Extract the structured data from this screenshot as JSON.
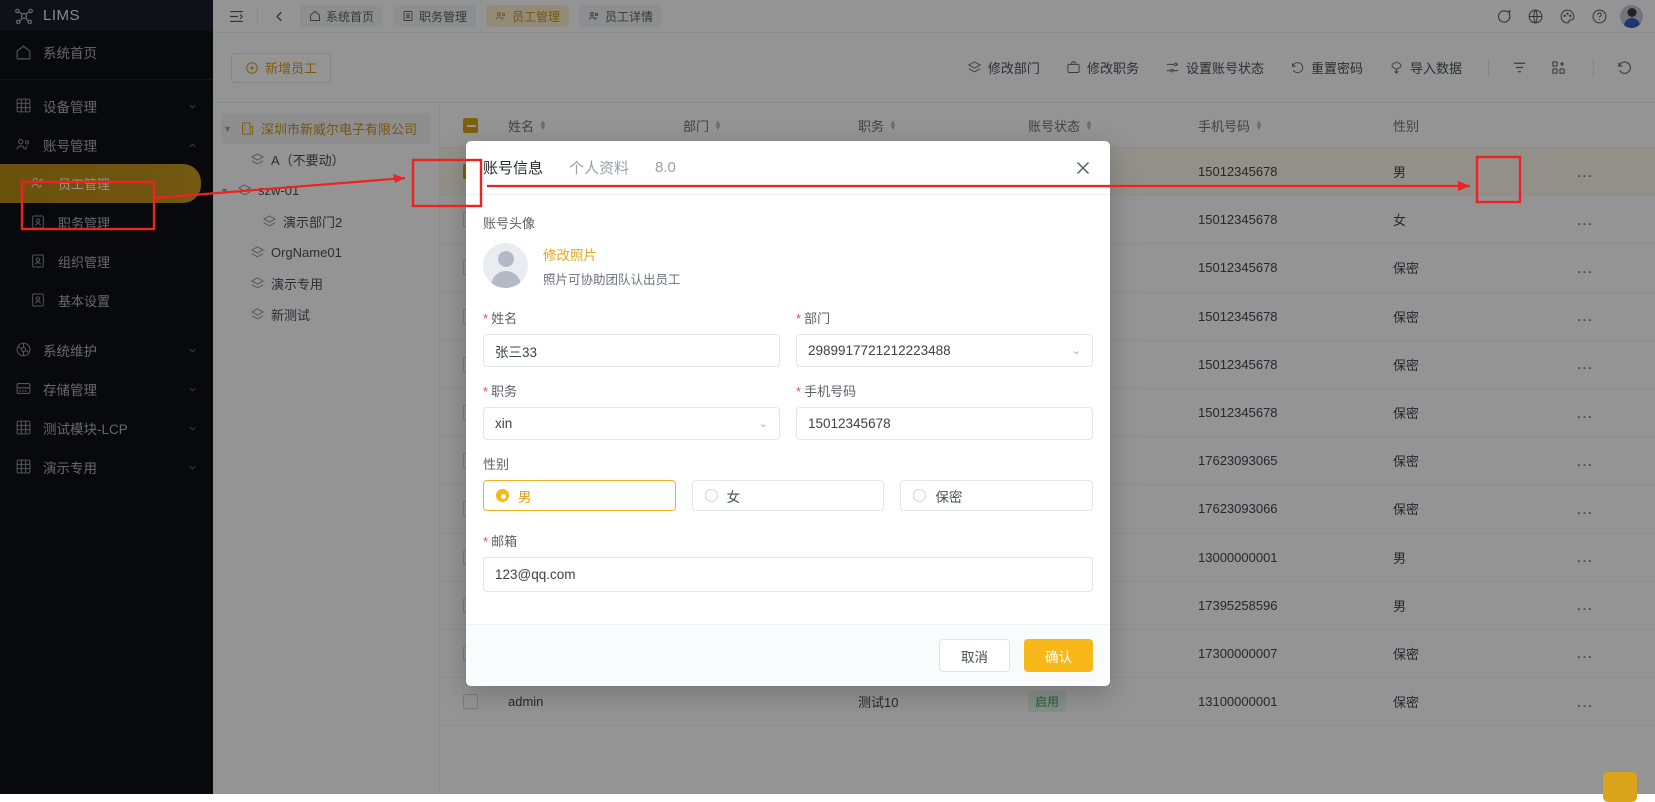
{
  "app": {
    "brand": "LIMS",
    "logo_icon": "molecule-logo-icon"
  },
  "sidebar": {
    "home": {
      "label": "系统首页",
      "icon": "home-icon"
    },
    "groups": [
      {
        "label": "设备管理",
        "icon": "grid-icon",
        "chevron": "chevron-down-icon",
        "expanded": false
      },
      {
        "label": "账号管理",
        "icon": "users-icon",
        "chevron": "chevron-up-icon",
        "expanded": true,
        "children": [
          {
            "label": "员工管理",
            "icon": "users-icon",
            "active": true
          },
          {
            "label": "职务管理",
            "icon": "id-card-icon",
            "active": false
          },
          {
            "label": "组织管理",
            "icon": "id-card-icon",
            "active": false
          },
          {
            "label": "基本设置",
            "icon": "id-card-icon",
            "active": false
          }
        ]
      },
      {
        "label": "系统维护",
        "icon": "wheel-icon",
        "chevron": "chevron-down-icon",
        "expanded": false
      },
      {
        "label": "存储管理",
        "icon": "storage-icon",
        "chevron": "chevron-down-icon",
        "expanded": false
      },
      {
        "label": "测试模块-LCP",
        "icon": "grid-icon",
        "chevron": "chevron-down-icon",
        "expanded": false
      },
      {
        "label": "演示专用",
        "icon": "grid-icon",
        "chevron": "chevron-down-icon",
        "expanded": false
      }
    ]
  },
  "topbar": {
    "collapse_icon": "sidebar-collapse-icon",
    "back_icon": "chevron-left-icon",
    "tabs": [
      {
        "label": "系统首页",
        "icon": "home-icon",
        "active": false
      },
      {
        "label": "职务管理",
        "icon": "id-card-icon",
        "active": false
      },
      {
        "label": "员工管理",
        "icon": "users-icon",
        "active": true
      },
      {
        "label": "员工详情",
        "icon": "users-icon",
        "active": false
      }
    ],
    "right_icons": [
      "chat-icon",
      "globe-icon",
      "palette-icon",
      "help-icon"
    ],
    "avatar": "user-avatar"
  },
  "actionbar": {
    "add_label": "新增员工",
    "add_icon": "plus-circle-icon",
    "actions": [
      {
        "label": "修改部门",
        "icon": "layers-icon"
      },
      {
        "label": "修改职务",
        "icon": "briefcase-icon"
      },
      {
        "label": "设置账号状态",
        "icon": "sliders-icon"
      },
      {
        "label": "重置密码",
        "icon": "reset-icon"
      },
      {
        "label": "导入数据",
        "icon": "import-icon"
      }
    ],
    "tool_icons": [
      "filter-icon",
      "columns-icon",
      "refresh-icon"
    ]
  },
  "tree": {
    "root": {
      "label": "深圳市新威尔电子有限公司",
      "icon": "company-icon",
      "caret": "caret-down-icon"
    },
    "nodes": [
      {
        "label": "A（不要动）",
        "icon": "layers-icon",
        "indent": 1,
        "caret": ""
      },
      {
        "label": "szw-01",
        "icon": "layers-icon",
        "indent": 1,
        "caret": "caret-down-icon"
      },
      {
        "label": "演示部门2",
        "icon": "layers-icon",
        "indent": 2,
        "caret": ""
      },
      {
        "label": "OrgName01",
        "icon": "layers-icon",
        "indent": 1,
        "caret": ""
      },
      {
        "label": "演示专用",
        "icon": "layers-icon",
        "indent": 1,
        "caret": ""
      },
      {
        "label": "新测试",
        "icon": "layers-icon",
        "indent": 1,
        "caret": ""
      }
    ]
  },
  "table": {
    "columns": [
      {
        "key": "name",
        "label": "姓名",
        "sortable": true
      },
      {
        "key": "dept",
        "label": "部门",
        "sortable": true
      },
      {
        "key": "job",
        "label": "职务",
        "sortable": true
      },
      {
        "key": "stat",
        "label": "账号状态",
        "sortable": true
      },
      {
        "key": "phone",
        "label": "手机号码",
        "sortable": true
      },
      {
        "key": "sex",
        "label": "性别",
        "sortable": false
      }
    ],
    "op_label": "…",
    "rows": [
      {
        "checked": true,
        "name": "",
        "dept": "",
        "job": "",
        "stat": "",
        "phone": "15012345678",
        "sex": "男"
      },
      {
        "checked": false,
        "name": "",
        "dept": "",
        "job": "",
        "stat": "",
        "phone": "15012345678",
        "sex": "女"
      },
      {
        "checked": false,
        "name": "",
        "dept": "",
        "job": "",
        "stat": "",
        "phone": "15012345678",
        "sex": "保密"
      },
      {
        "checked": false,
        "name": "",
        "dept": "",
        "job": "",
        "stat": "",
        "phone": "15012345678",
        "sex": "保密"
      },
      {
        "checked": false,
        "name": "",
        "dept": "",
        "job": "",
        "stat": "",
        "phone": "15012345678",
        "sex": "保密"
      },
      {
        "checked": false,
        "name": "",
        "dept": "",
        "job": "",
        "stat": "",
        "phone": "15012345678",
        "sex": "保密"
      },
      {
        "checked": false,
        "name": "",
        "dept": "",
        "job": "",
        "stat": "",
        "phone": "17623093065",
        "sex": "保密"
      },
      {
        "checked": false,
        "name": "",
        "dept": "",
        "job": "",
        "stat": "",
        "phone": "17623093066",
        "sex": "保密"
      },
      {
        "checked": false,
        "name": "",
        "dept": "",
        "job": "",
        "stat": "",
        "phone": "13000000001",
        "sex": "男"
      },
      {
        "checked": false,
        "name": "",
        "dept": "",
        "job": "",
        "stat": "",
        "phone": "17395258596",
        "sex": "男"
      },
      {
        "checked": false,
        "name": "",
        "dept": "",
        "job": "",
        "stat": "",
        "phone": "17300000007",
        "sex": "保密"
      },
      {
        "checked": false,
        "name": "admin",
        "dept": "",
        "job": "测试10",
        "stat": "启用",
        "phone": "13100000001",
        "sex": "保密"
      }
    ]
  },
  "modal": {
    "tabs": [
      {
        "label": "账号信息",
        "active": true
      },
      {
        "label": "个人资料",
        "active": false
      },
      {
        "label": "8.0",
        "active": false
      }
    ],
    "close_icon": "close-icon",
    "avatar_section_label": "账号头像",
    "avatar_link": "修改照片",
    "avatar_hint": "照片可协助团队认出员工",
    "fields": {
      "name": {
        "label": "姓名",
        "required": true,
        "value": "张三33"
      },
      "dept": {
        "label": "部门",
        "required": true,
        "value": "2989917721212223488",
        "type": "select"
      },
      "job": {
        "label": "职务",
        "required": true,
        "value": "xin",
        "type": "select"
      },
      "phone": {
        "label": "手机号码",
        "required": true,
        "value": "15012345678"
      },
      "email": {
        "label": "邮箱",
        "required": true,
        "value": "123@qq.com"
      }
    },
    "gender": {
      "label": "性别",
      "options": [
        {
          "label": "男",
          "selected": true
        },
        {
          "label": "女",
          "selected": false
        },
        {
          "label": "保密",
          "selected": false
        }
      ]
    },
    "cancel_label": "取消",
    "confirm_label": "确认"
  },
  "colors": {
    "accent": "#f8b81a",
    "sidebar_bg": "#0f1117",
    "active_nav": "#c0921a",
    "annotation": "#ee2222",
    "status_green": "#3fa35a"
  }
}
